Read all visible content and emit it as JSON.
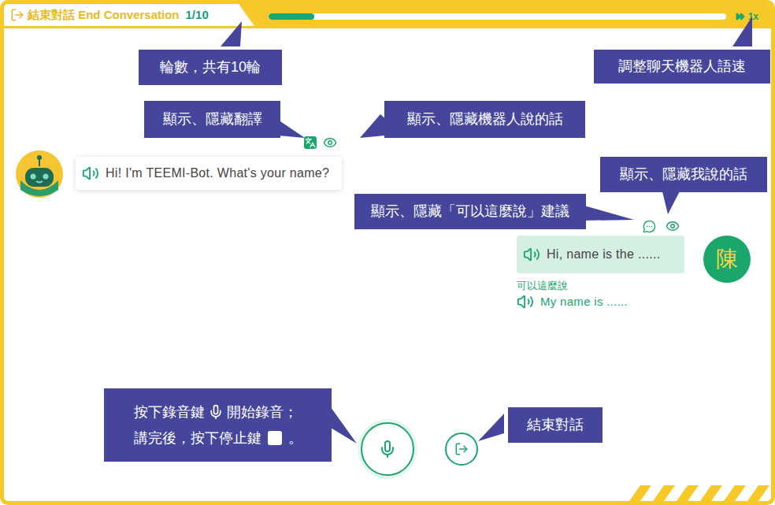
{
  "header": {
    "exit_label": "結束對話 End Conversation",
    "round": "1/10",
    "progress": {
      "level": 0.1
    },
    "speed": "1x"
  },
  "bot": {
    "message": "Hi! I'm TEEMI-Bot. What's your name?"
  },
  "user": {
    "avatar": "陳",
    "message": "Hi, name is the ......",
    "suggestion_label": "可以這麼說",
    "suggestion": "My name is ......"
  },
  "annotations": [
    {
      "kind": "text",
      "text": "輪數，共有10輪"
    },
    {
      "kind": "text",
      "text": "調整聊天機器人語速"
    },
    {
      "kind": "text",
      "text": "顯示、隱藏翻譯"
    },
    {
      "kind": "text",
      "text": "顯示、隱藏機器人說的話"
    },
    {
      "kind": "text",
      "text": "顯示、隱藏我說的話"
    },
    {
      "kind": "text",
      "text": "顯示、隱藏「可以這麼說」建議"
    },
    {
      "kind": "record",
      "line1_before": "按下錄音鍵",
      "line1_after": "開始錄音；",
      "line2_before": "講完後，按下停止鍵",
      "line2_after": "。"
    },
    {
      "kind": "text",
      "text": "結束對話"
    }
  ]
}
